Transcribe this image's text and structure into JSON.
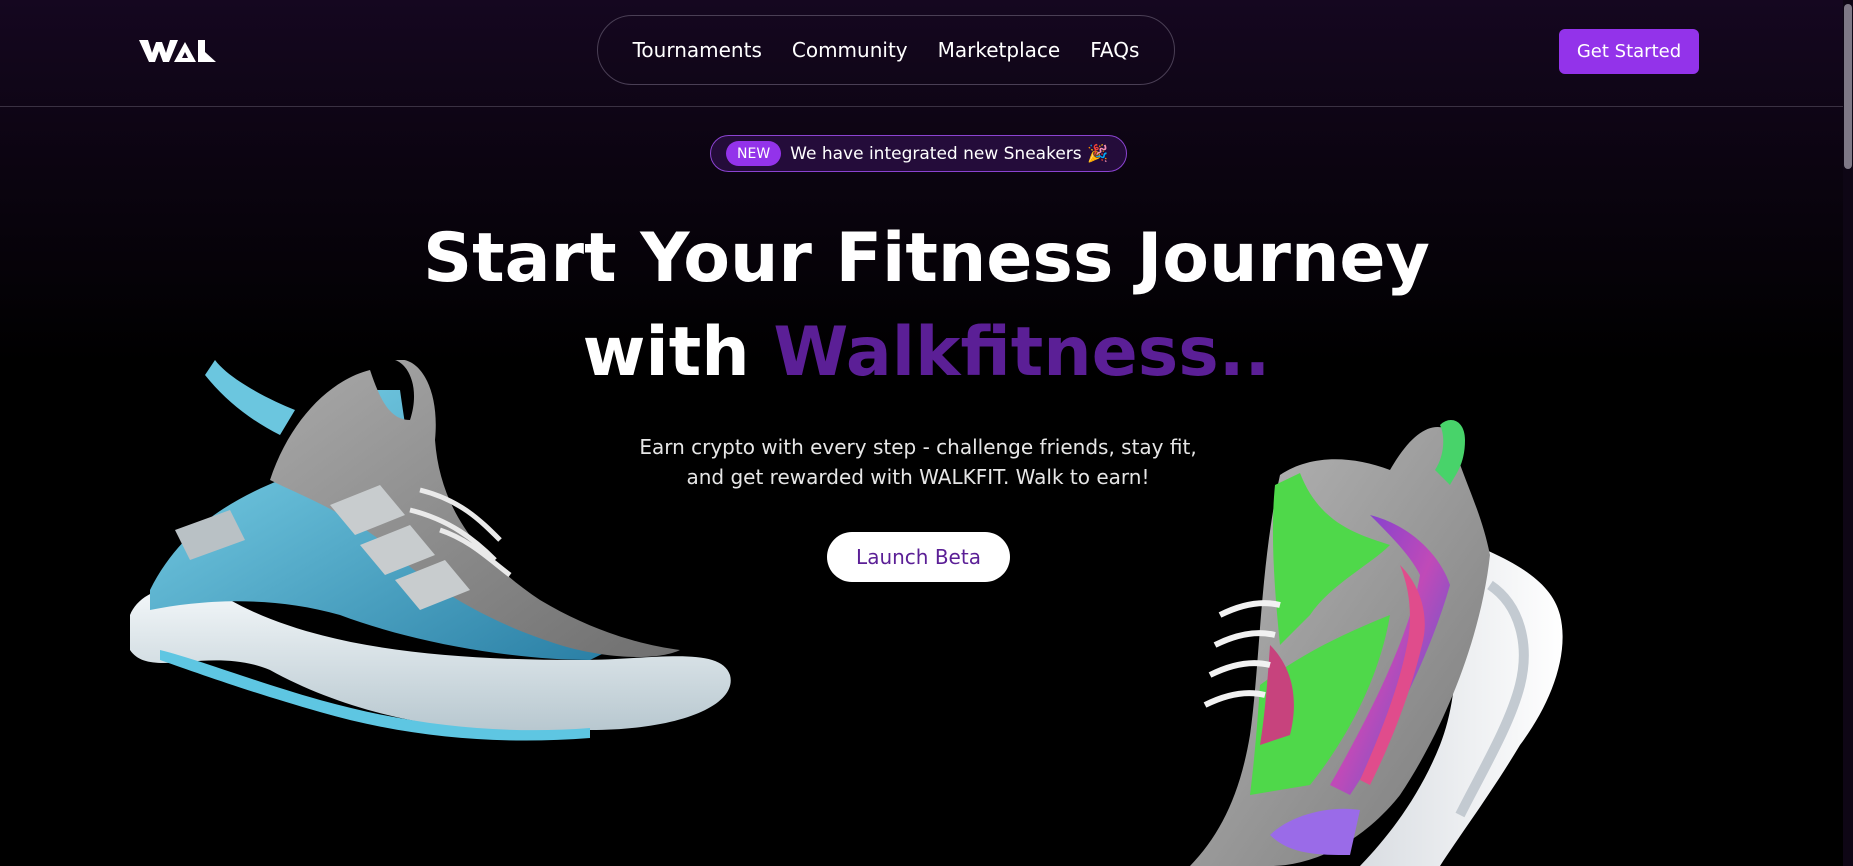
{
  "brand": {
    "logo_name": "WAL",
    "accent_color": "#9333ea",
    "heading_accent_color": "#5b1f96"
  },
  "nav": {
    "items": [
      {
        "label": "Tournaments"
      },
      {
        "label": "Community"
      },
      {
        "label": "Marketplace"
      },
      {
        "label": "FAQs"
      }
    ],
    "cta_label": "Get Started"
  },
  "announcement": {
    "tag": "NEW",
    "text": "We have integrated new Sneakers 🎉"
  },
  "hero": {
    "title_line1": "Start Your Fitness Journey",
    "title_line2_prefix": "with ",
    "title_line2_accent": "Walkfitness..",
    "subtitle_line1": "Earn crypto with every step - challenge friends, stay fit,",
    "subtitle_line2": "and get rewarded with WALKFIT. Walk to earn!",
    "button_label": "Launch Beta"
  },
  "images": {
    "left": "blue-gray-sneaker",
    "right": "green-purple-sneaker"
  }
}
